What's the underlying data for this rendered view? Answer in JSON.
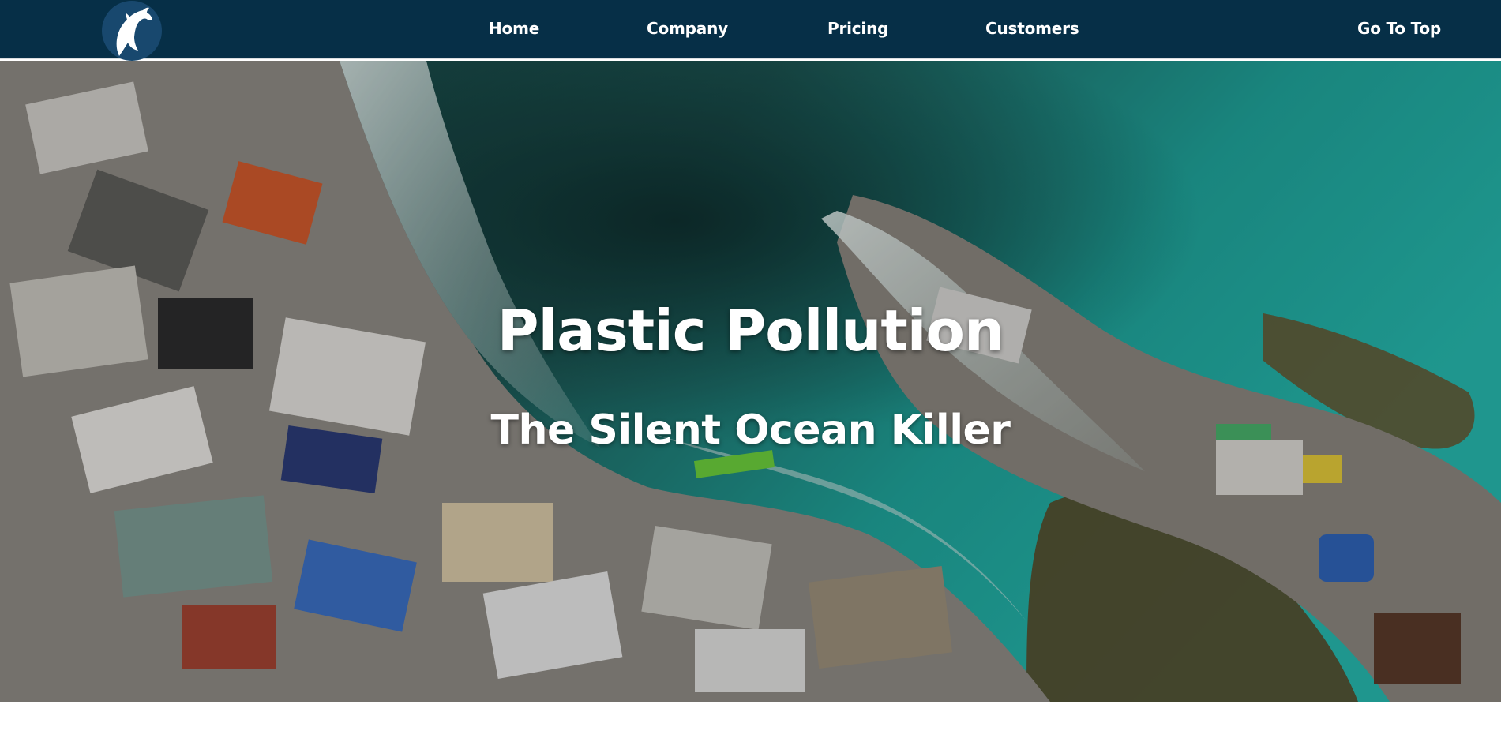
{
  "nav": {
    "logo_icon": "dolphin-icon",
    "links": [
      {
        "label": "Home"
      },
      {
        "label": "Company"
      },
      {
        "label": "Pricing"
      },
      {
        "label": "Customers"
      }
    ],
    "go_to_top": "Go To Top"
  },
  "hero": {
    "title": "Plastic Pollution",
    "subtitle": "The Silent Ocean Killer",
    "image": "ocean-shore-covered-in-plastic-waste"
  },
  "colors": {
    "navbar": "#062f47",
    "logo_bg": "#18486e",
    "text": "#ffffff"
  }
}
